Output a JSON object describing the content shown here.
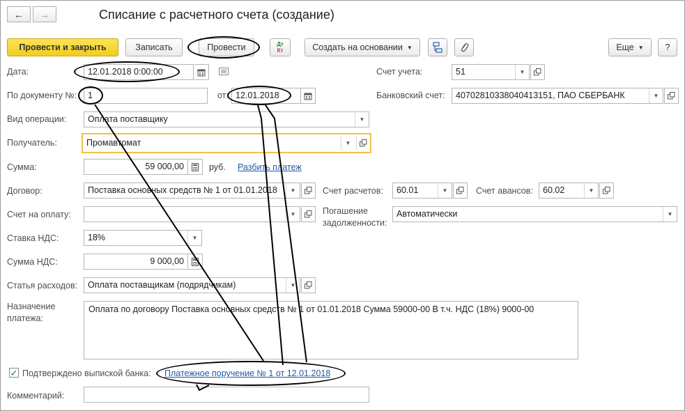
{
  "window": {
    "title": "Списание с расчетного счета (создание)",
    "nav_back": "←",
    "nav_forward": "→"
  },
  "toolbar": {
    "post_close": "Провести и закрыть",
    "save": "Записать",
    "post": "Провести",
    "dtkt_top": "Дт",
    "dtkt_bottom": "Кт",
    "create_based": "Создать на основании",
    "more": "Еще",
    "help": "?"
  },
  "form": {
    "date_label": "Дата:",
    "date_value": "12.01.2018  0:00:00",
    "doc_no_label": "По документу №:",
    "doc_no_value": "1",
    "from_label": "от:",
    "from_value": "12.01.2018",
    "account_label": "Счет учета:",
    "account_value": "51",
    "bank_account_label": "Банковский счет:",
    "bank_account_value": "40702810338040413151, ПАО СБЕРБАНК",
    "operation_label": "Вид операции:",
    "operation_value": "Оплата поставщику",
    "recipient_label": "Получатель:",
    "recipient_value": "Промавтомат",
    "sum_label": "Сумма:",
    "sum_value": "59 000,00",
    "currency": "руб.",
    "split_link": "Разбить платеж",
    "contract_label": "Договор:",
    "contract_value": "Поставка основных средств № 1 от 01.01.2018",
    "settle_acc_label": "Счет расчетов:",
    "settle_acc_value": "60.01",
    "advance_acc_label": "Счет авансов:",
    "advance_acc_value": "60.02",
    "invoice_label": "Счет на оплату:",
    "invoice_value": "",
    "debt_label_1": "Погашение",
    "debt_label_2": "задолженности:",
    "debt_value": "Автоматически",
    "vat_rate_label": "Ставка НДС:",
    "vat_rate_value": "18%",
    "vat_sum_label": "Сумма НДС:",
    "vat_sum_value": "9 000,00",
    "expense_label": "Статья расходов:",
    "expense_value": "Оплата поставщикам (подрядчикам)",
    "purpose_label_1": "Назначение",
    "purpose_label_2": "платежа:",
    "purpose_value": "Оплата по договору Поставка основных средств № 1 от 01.01.2018 Сумма 59000-00 В т.ч. НДС  (18%) 9000-00",
    "confirmed_label": "Подтверждено выпиской банка:",
    "confirmed_checked": true,
    "payment_order_link": "Платежное поручение № 1 от 12.01.2018",
    "comment_label": "Комментарий:",
    "comment_value": ""
  },
  "icons": {
    "calendar": "calendar-icon",
    "open": "open-icon",
    "dropdown": "dropdown-arrow-icon",
    "calculator": "calculator-icon",
    "structure": "structure-icon",
    "attach": "paperclip-icon",
    "list": "list-icon"
  },
  "colors": {
    "primary_button": "#f5d22a",
    "link": "#1f5aa6",
    "focus_border": "#f0c242",
    "check": "#2a8a2a"
  }
}
